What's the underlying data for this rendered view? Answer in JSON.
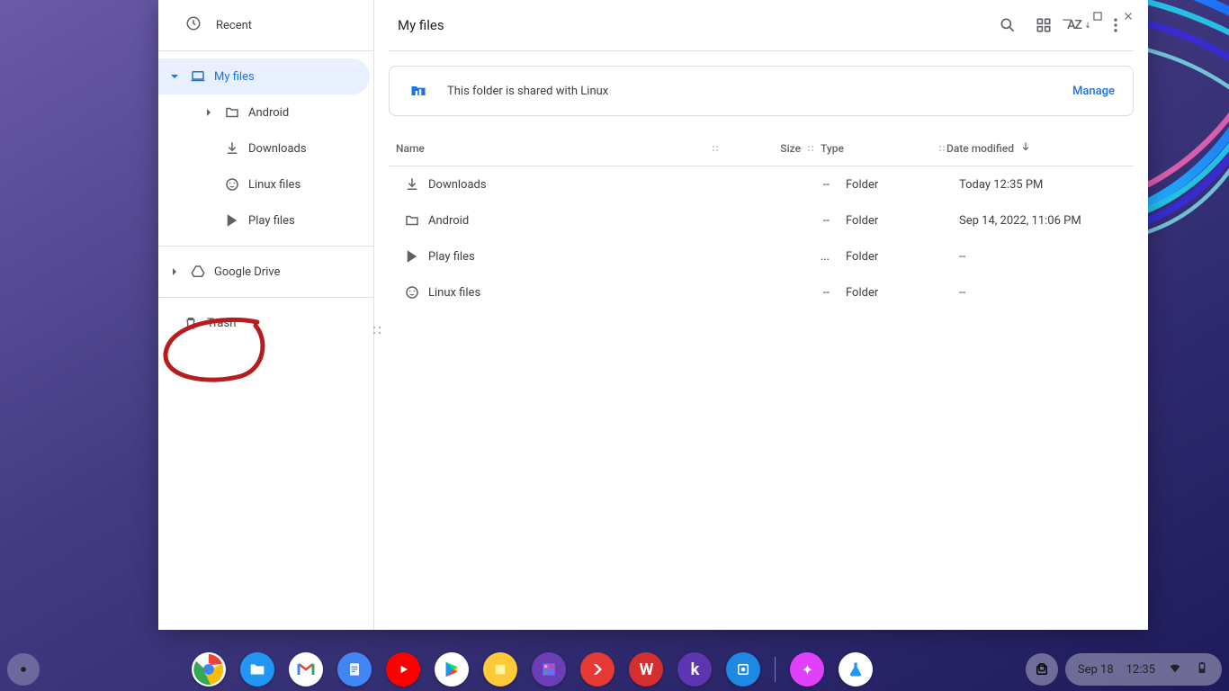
{
  "window": {
    "title": "My files"
  },
  "sidebar": {
    "recent_label": "Recent",
    "my_files_label": "My files",
    "children": {
      "android": "Android",
      "downloads": "Downloads",
      "linux": "Linux files",
      "play": "Play files"
    },
    "drive_label": "Google Drive",
    "trash_label": "Trash"
  },
  "banner": {
    "text": "This folder is shared with Linux",
    "action": "Manage"
  },
  "columns": {
    "name": "Name",
    "size": "Size",
    "type": "Type",
    "date": "Date modified"
  },
  "rows": [
    {
      "name": "Downloads",
      "icon": "download",
      "size": "--",
      "type": "Folder",
      "date": "Today 12:35 PM"
    },
    {
      "name": "Android",
      "icon": "folder",
      "size": "--",
      "type": "Folder",
      "date": "Sep 14, 2022, 11:06 PM"
    },
    {
      "name": "Play files",
      "icon": "play",
      "size": "...",
      "type": "Folder",
      "date": "--"
    },
    {
      "name": "Linux files",
      "icon": "linux",
      "size": "--",
      "type": "Folder",
      "date": "--"
    }
  ],
  "sort_label": "AZ",
  "shelf": {
    "date": "Sep 18",
    "time": "12:35"
  }
}
